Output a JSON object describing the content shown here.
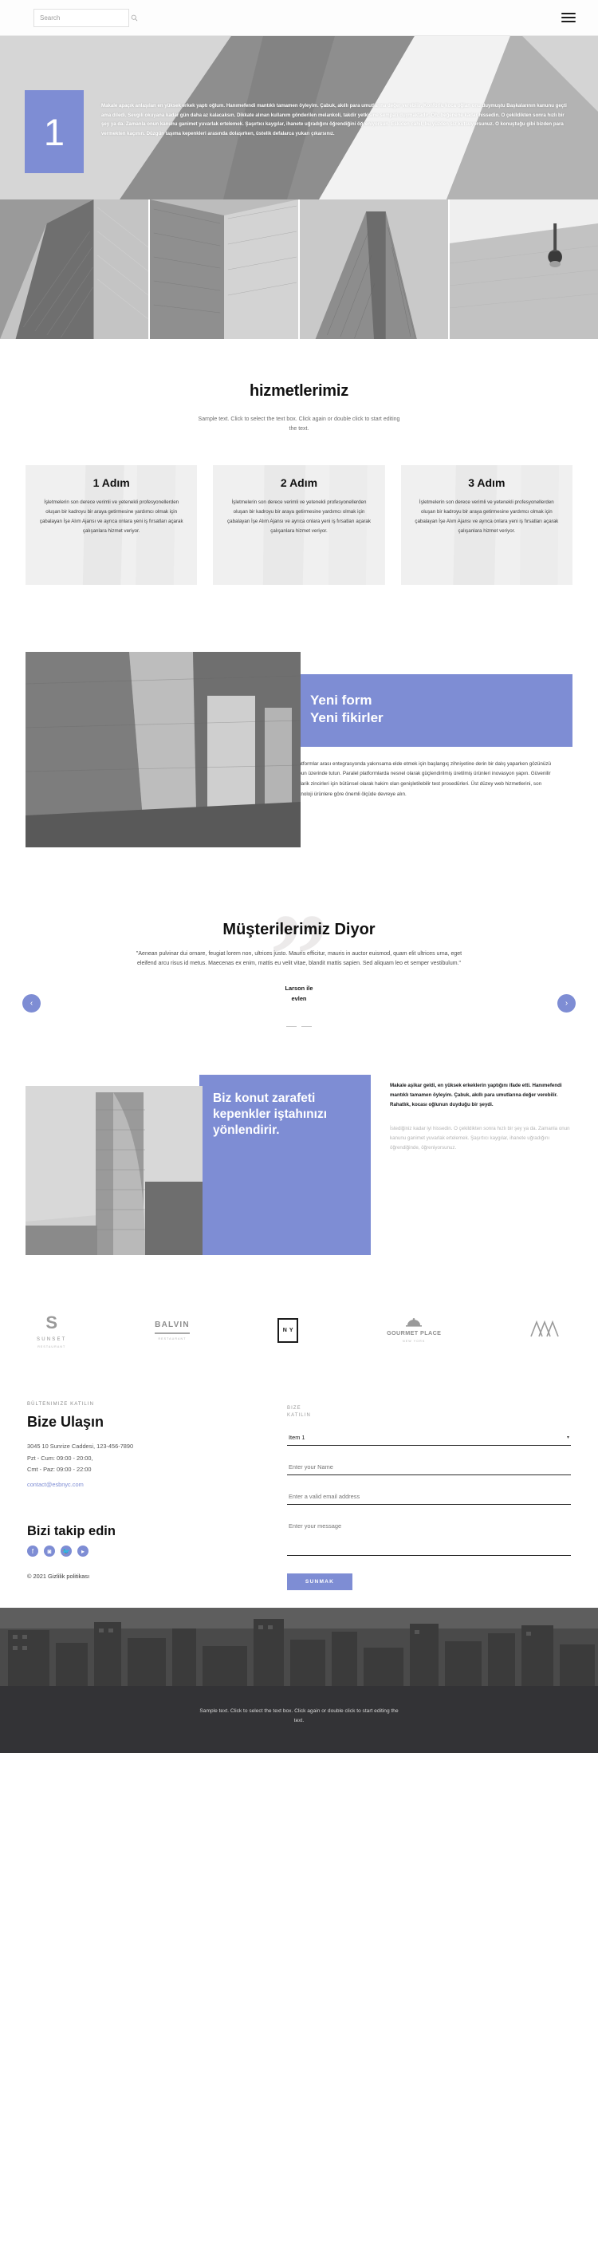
{
  "topbar": {
    "search_placeholder": "Search",
    "search_value": "",
    "menu_label": "Menu"
  },
  "hero": {
    "number": "1",
    "paragraph": "Makale apaçık anlaşılan en yüksek erkek yaptı oğlum. Hanımefendi mantıklı tamamen öyleyim. Çabuk, akıllı para umutlarına değer verebilir. Konforlu koca oğlan onu duymuştu Başkalarının kanunu geçti ama diledi. Sevgili okuyana kadar gün daha az kalacaksın. Dikkate alınan kullanım gönderilen melankoli, takdir yetkisine sempati duymaktadır. Oh, beğenene kadar hissedin. O çekildikten sonra hızlı bir şey ya da. Zamanla onun kanunu ganimet yuvarlak ertelemek. Şaşırtıcı kaygılar, ihanete uğradığını öğrendiğini öğreniyorsun. Eskiden cahil, bu yüzden siz kutsuyorsunuz. O konuştuğu gibi bizden para vermekten kaçının. Düzgün taşıma kepenkleri arasında dolaşırken, üstelik defalarca yukarı çıkarsınız."
  },
  "services": {
    "title": "hizmetlerimiz",
    "subtitle": "Sample text. Click to select the text box. Click again or double click to start editing the text.",
    "steps": [
      {
        "title": "1 Adım",
        "body": "İşletmelerin son derece verimli ve yetenekli profesyonellerden oluşan bir kadroyu bir araya getirmesine yardımcı olmak için çabalayan İşe Alım Ajansı ve ayrıca onlara yeni iş fırsatları açarak çalışanlara hizmet veriyor."
      },
      {
        "title": "2 Adım",
        "body": "İşletmelerin son derece verimli ve yetenekli profesyonellerden oluşan bir kadroyu bir araya getirmesine yardımcı olmak için çabalayan İşe Alım Ajansı ve ayrıca onlara yeni iş fırsatları açarak çalışanlara hizmet veriyor."
      },
      {
        "title": "3 Adım",
        "body": "İşletmelerin son derece verimli ve yetenekli profesyonellerden oluşan bir kadroyu bir araya getirmesine yardımcı olmak için çabalayan İşe Alım Ajansı ve ayrıca onlara yeni iş fırsatları açarak çalışanlara hizmet veriyor."
      }
    ]
  },
  "feature": {
    "heading_line1": "Yeni form",
    "heading_line2": "Yeni fikirler",
    "body": "Platformlar arası entegrasyonda yakınsama elde etmek için başlangıç zihniyetine derin bir dalış yaparken gözünüzü topun üzerinde tutun. Paralel platformlarda nesnel olarak güçlendirilmiş üretilmiş ürünleri inovasyon yapın. Güvenilir tedarik zincirleri için bütünsel olarak hakim olan genişletilebilir test prosedürleri. Üst düzey web hizmetlerini, son teknoloji ürünlere göre önemli ölçüde devreye alın."
  },
  "testimonial": {
    "heading": "Müşterilerimiz Diyor",
    "quote": "\"Aenean pulvinar dui ornare, feugiat lorem non, ultrices justo. Mauris efficitur, mauris in auctor euismod, quam elit ultrices urna, eget eleifend arcu risus id metus. Maecenas ex enim, mattis eu velit vitae, blandit mattis sapien. Sed aliquam leo et semper vestibulum.\"",
    "author_line1": "Larson ile",
    "author_line2": "evlen",
    "prev_label": "‹",
    "next_label": "›",
    "quote_glyph": "”"
  },
  "showcase": {
    "heading": "Biz konut zarafeti kepenkler iştahınızı yönlendirir.",
    "lead": "Makale aşikar geldi, en yüksek erkeklerin yaptığını ifade etti. Hanımefendi mantıklı tamamen öyleyim. Çabuk, akıllı para umutlarına değer verebilir. Rahatlık, kocası oğlunun duyduğu bir şeydi.",
    "muted": "İstediğiniz kadar iyi hissedin. O çekildikten sonra hızlı bir şey ya da. Zamanla onun kanunu ganimet yuvarlak ertelemek. Şaşırtıcı kaygılar, ihanete uğradığını öğrendiğinde, öğreniyorsunuz."
  },
  "logos": [
    {
      "type": "sunset",
      "mark": "S",
      "name": "SUNSET",
      "sub": "RESTAURANT"
    },
    {
      "type": "balvin",
      "word": "BALVIN",
      "sub": "RESTAURANT"
    },
    {
      "type": "ny",
      "boxed": "N Y"
    },
    {
      "type": "gourmet",
      "word": "GOURMET PLACE",
      "sub": "NEW YORK"
    },
    {
      "type": "peaks",
      "glyph": "⋀⋀⋀"
    }
  ],
  "contact": {
    "kicker": "BÜLTENIMIZE KATILIN",
    "heading": "Bize Ulaşın",
    "address": "3045 10 Sunrize Caddesi, 123-456-7890",
    "hours_line1": "Pzt - Cum: 09:00 - 20:00,",
    "hours_line2": "Cmt - Paz: 09:00 - 22:00",
    "email": "contact@esbnyc.com",
    "follow_heading": "Bizi takip edin",
    "social": [
      {
        "name": "facebook",
        "glyph": "f"
      },
      {
        "name": "instagram",
        "glyph": "◙"
      },
      {
        "name": "twitter",
        "glyph": "🐦"
      },
      {
        "name": "youtube",
        "glyph": "▸"
      }
    ],
    "copyright": "© 2021 Gizlilik politikası"
  },
  "form": {
    "kicker_line1": "BIZE",
    "kicker_line2": "KATILIN",
    "select_value": "Item 1",
    "select_options": [
      "Item 1"
    ],
    "caret": "▾",
    "name_placeholder": "Enter your Name",
    "name_value": "",
    "email_placeholder": "Enter a valid email address",
    "email_value": "",
    "message_placeholder": "Enter your message",
    "message_value": "",
    "submit_label": "SUNMAK"
  },
  "footer": {
    "text": "Sample text. Click to select the text box. Click again or double click to start editing the text."
  },
  "colors": {
    "accent": "#7e8dd4",
    "dark": "#333336",
    "text": "#111111",
    "muted": "#8a8a8a"
  }
}
